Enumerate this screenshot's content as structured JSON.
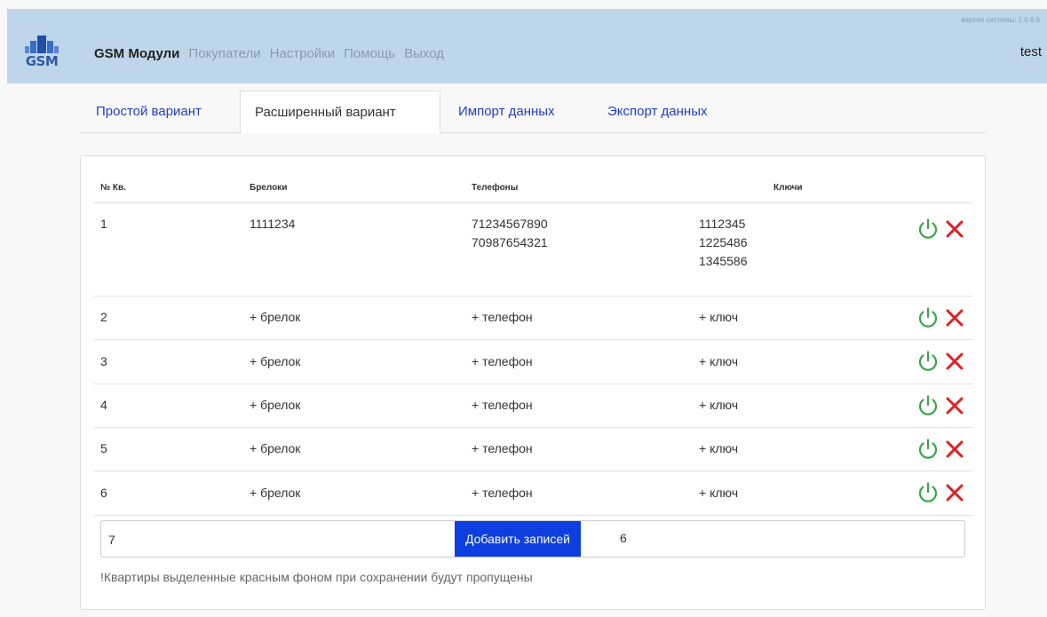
{
  "header": {
    "logo_text": "GSM",
    "nav": [
      "GSM Модули",
      "Покупатели",
      "Настройки",
      "Помощь",
      "Выход"
    ],
    "version": "версия системы: 1.0.6.6",
    "user": "test"
  },
  "tabs": [
    "Простой вариант",
    "Расширенный вариант",
    "Импорт данных",
    "Экспорт данных"
  ],
  "table": {
    "headers": [
      "№ Кв.",
      "Брелоки",
      "Телефоны",
      "Ключи"
    ],
    "rows": [
      {
        "num": "1",
        "fobs": "1111234",
        "phones": "71234567890\n70987654321",
        "keys": "1112345\n1225486\n1345586"
      },
      {
        "num": "2",
        "fobs": "+ брелок",
        "phones": "+ телефон",
        "keys": "+ ключ"
      },
      {
        "num": "3",
        "fobs": "+ брелок",
        "phones": "+ телефон",
        "keys": "+ ключ"
      },
      {
        "num": "4",
        "fobs": "+ брелок",
        "phones": "+ телефон",
        "keys": "+ ключ"
      },
      {
        "num": "5",
        "fobs": "+ брелок",
        "phones": "+ телефон",
        "keys": "+ ключ"
      },
      {
        "num": "6",
        "fobs": "+ брелок",
        "phones": "+ телефон",
        "keys": "+ ключ"
      }
    ]
  },
  "add": {
    "input_value": "7",
    "button_label": "Добавить записей",
    "count": "6"
  },
  "note": "!Квартиры выделенные красным фоном при сохранении будут пропущены",
  "colors": {
    "power": "#3aa648",
    "delete": "#dd2222",
    "button": "#0c3ee0",
    "link": "#1f3fc8"
  }
}
